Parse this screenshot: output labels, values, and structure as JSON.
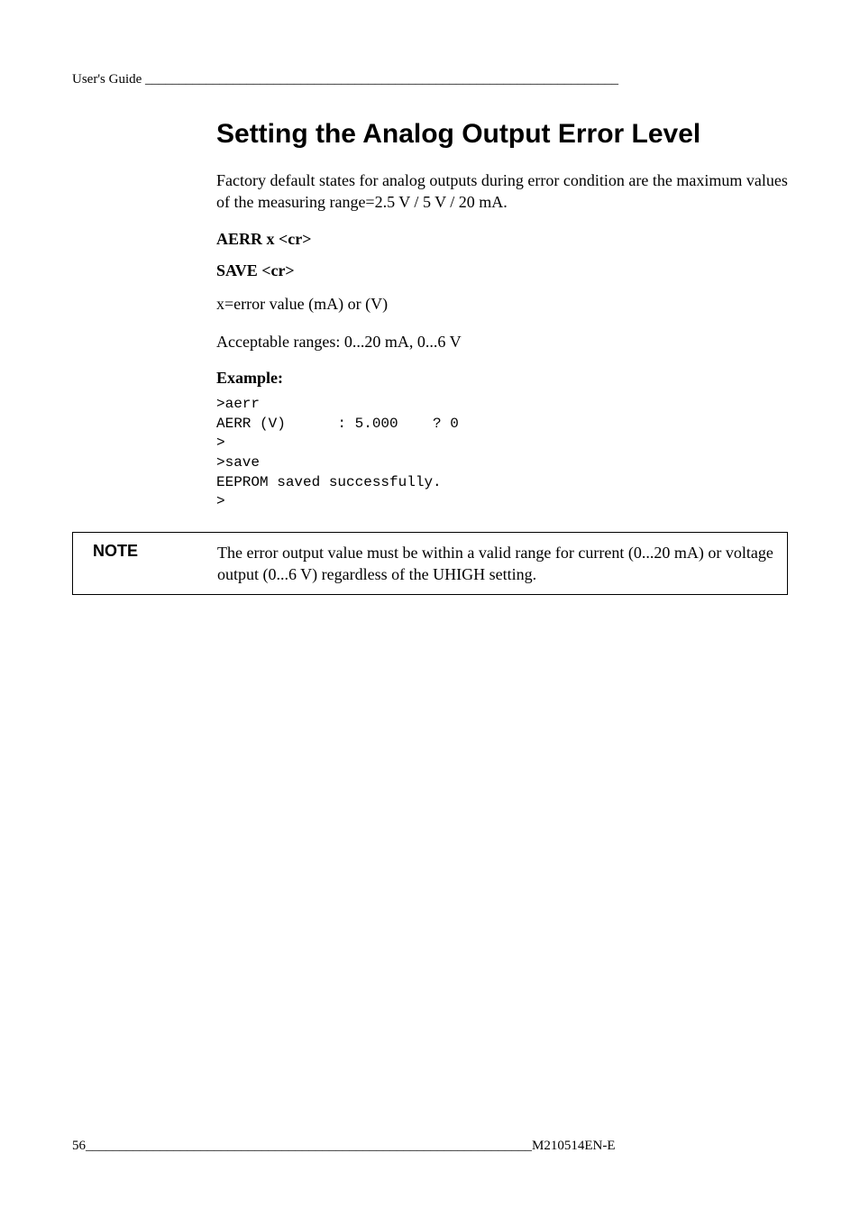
{
  "header": {
    "text": "User's Guide ______________________________________________________________________"
  },
  "section": {
    "title": "Setting the Analog Output Error Level",
    "intro": "Factory default states for analog outputs during error condition are the maximum values of the measuring range=2.5 V / 5 V / 20 mA.",
    "command1": "AERR x <cr>",
    "command2": "SAVE <cr>",
    "param_desc": "x=error value (mA) or (V)",
    "ranges": "Acceptable ranges: 0...20 mA, 0...6 V",
    "example_label": "Example:",
    "code": ">aerr\nAERR (V)      : 5.000    ? 0\n>\n>save\nEEPROM saved successfully.\n>"
  },
  "note": {
    "label": "NOTE",
    "text": "The error output value must be within a valid range for current (0...20 mA) or voltage output (0...6 V) regardless of the UHIGH setting."
  },
  "footer": {
    "page": "56",
    "fill": " __________________________________________________________________",
    "docref": "M210514EN-E"
  }
}
